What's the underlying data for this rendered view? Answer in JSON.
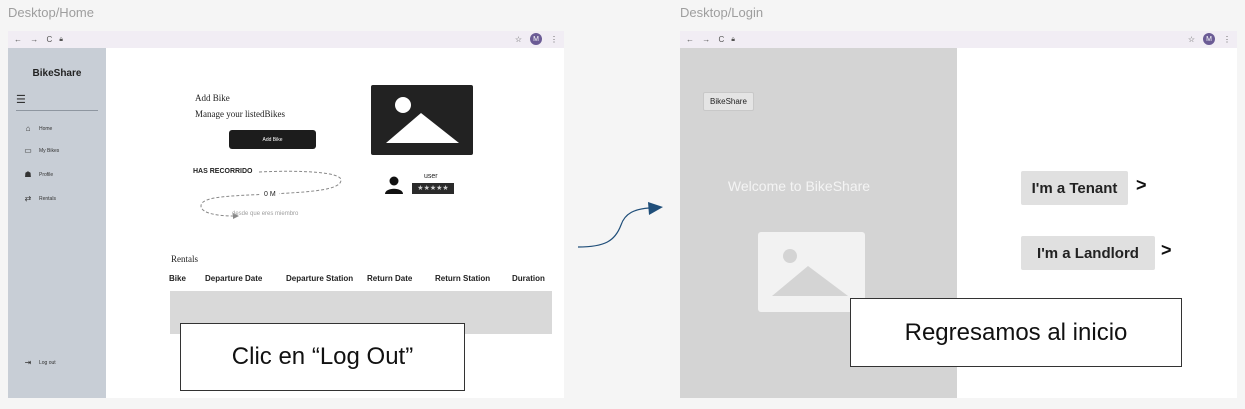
{
  "frames": {
    "home_label": "Desktop/Home",
    "login_label": "Desktop/Login"
  },
  "browser": {
    "nav": "← → C",
    "lock_icon": "lock-icon",
    "star": "☆",
    "profile_initial": "M",
    "menu": "⋮"
  },
  "home": {
    "sidebar": {
      "brand": "BikeShare",
      "items": [
        {
          "label": "Home",
          "icon": "⌂"
        },
        {
          "label": "My Bikes",
          "icon": "▭"
        },
        {
          "label": "Profile",
          "icon": "☗"
        },
        {
          "label": "Rentals",
          "icon": "⇄"
        }
      ],
      "logout": "Log out"
    },
    "add_bike_title": "Add Bike",
    "manage_text": "Manage your listedBikes",
    "add_bike_button": "Add Bike",
    "distance_label": "HAS RECORRIDO",
    "distance_value": "0 M",
    "since_text": "desde que eres miembro",
    "user_label": "user",
    "stars": "★★★★★",
    "rentals_title": "Rentals",
    "table_headers": [
      "Bike",
      "Departure Date",
      "Departure Station",
      "Return Date",
      "Return Station",
      "Duration"
    ],
    "annotation": "Clic en “Log Out”"
  },
  "login": {
    "brand_button": "BikeShare",
    "welcome": "Welcome to BikeShare",
    "tenant_button": "I'm a Tenant",
    "landlord_button": "I'm a Landlord",
    "annotation": "Regresamos al inicio"
  },
  "colors": {
    "sidebar": "#c8ced6",
    "login_panel": "#d4d4d4",
    "arrow": "#1f4e79"
  }
}
